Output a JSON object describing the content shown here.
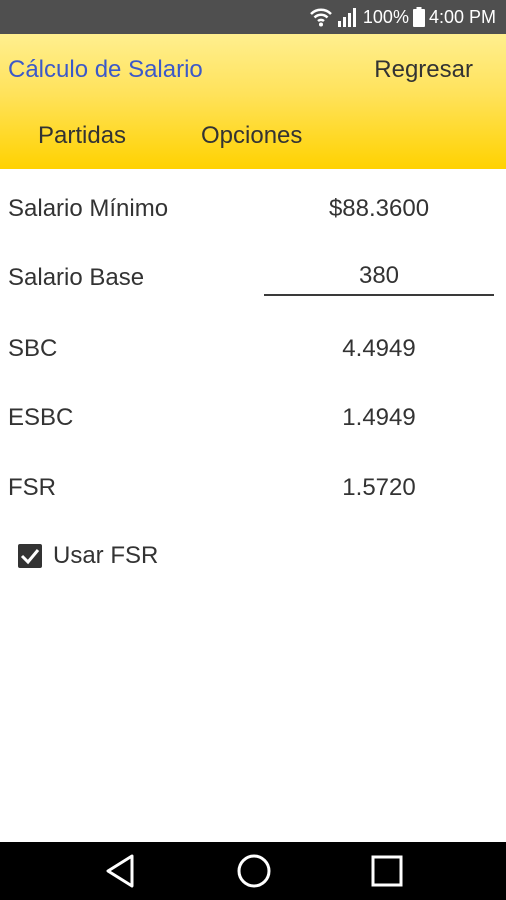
{
  "status_bar": {
    "battery": "100%",
    "time": "4:00 PM"
  },
  "header": {
    "title": "Cálculo de Salario",
    "back_label": "Regresar",
    "tabs": [
      {
        "label": "Partidas"
      },
      {
        "label": "Opciones"
      }
    ]
  },
  "form": {
    "rows": [
      {
        "label": "Salario Mínimo",
        "value": "$88.3600"
      },
      {
        "label": "Salario Base",
        "value": "380"
      },
      {
        "label": "SBC",
        "value": "4.4949"
      },
      {
        "label": "ESBC",
        "value": "1.4949"
      },
      {
        "label": "FSR",
        "value": "1.5720"
      }
    ],
    "checkbox": {
      "label": "Usar FSR",
      "checked": true
    }
  },
  "icons": {
    "wifi": "wifi-icon",
    "signal": "signal-icon",
    "battery": "battery-icon",
    "checkmark": "checkmark-icon",
    "nav_back": "nav-back-icon",
    "nav_home": "nav-home-icon",
    "nav_recents": "nav-recents-icon"
  },
  "colors": {
    "title_blue": "#3c59c9",
    "header_yellow": "#ffd200",
    "status_bar": "#4f4f4f",
    "nav_bar": "#000000"
  }
}
